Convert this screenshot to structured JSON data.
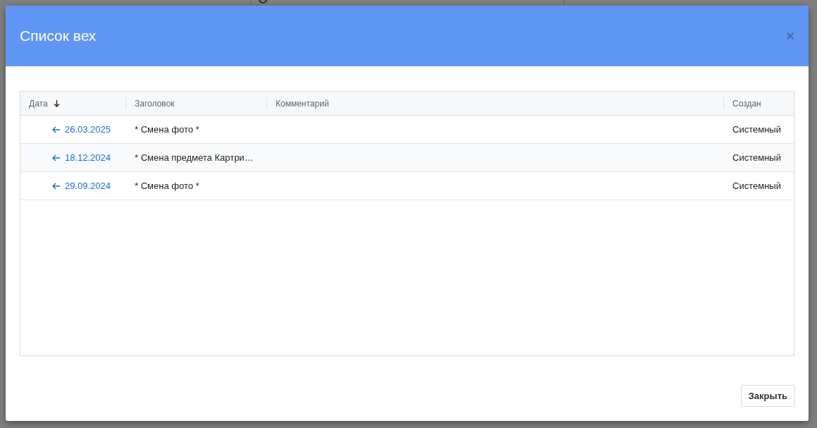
{
  "dialog": {
    "title": "Список вех",
    "close": "×",
    "table": {
      "columns": [
        {
          "label": "Дата",
          "sorted": true
        },
        {
          "label": "Заголовок",
          "sorted": false
        },
        {
          "label": "Комментарий",
          "sorted": false
        },
        {
          "label": "Создан",
          "sorted": false
        }
      ],
      "rows": [
        {
          "date": "26.03.2025",
          "title": "* Смена фото *",
          "created_by": "Системный"
        },
        {
          "date": "18.12.2024",
          "title": "* Смена предмета Картри…",
          "created_by": "Системный"
        },
        {
          "date": "29.09.2024",
          "title": "* Смена фото *",
          "created_by": "Системный"
        }
      ]
    },
    "buttons": [
      "Закрыть"
    ]
  }
}
